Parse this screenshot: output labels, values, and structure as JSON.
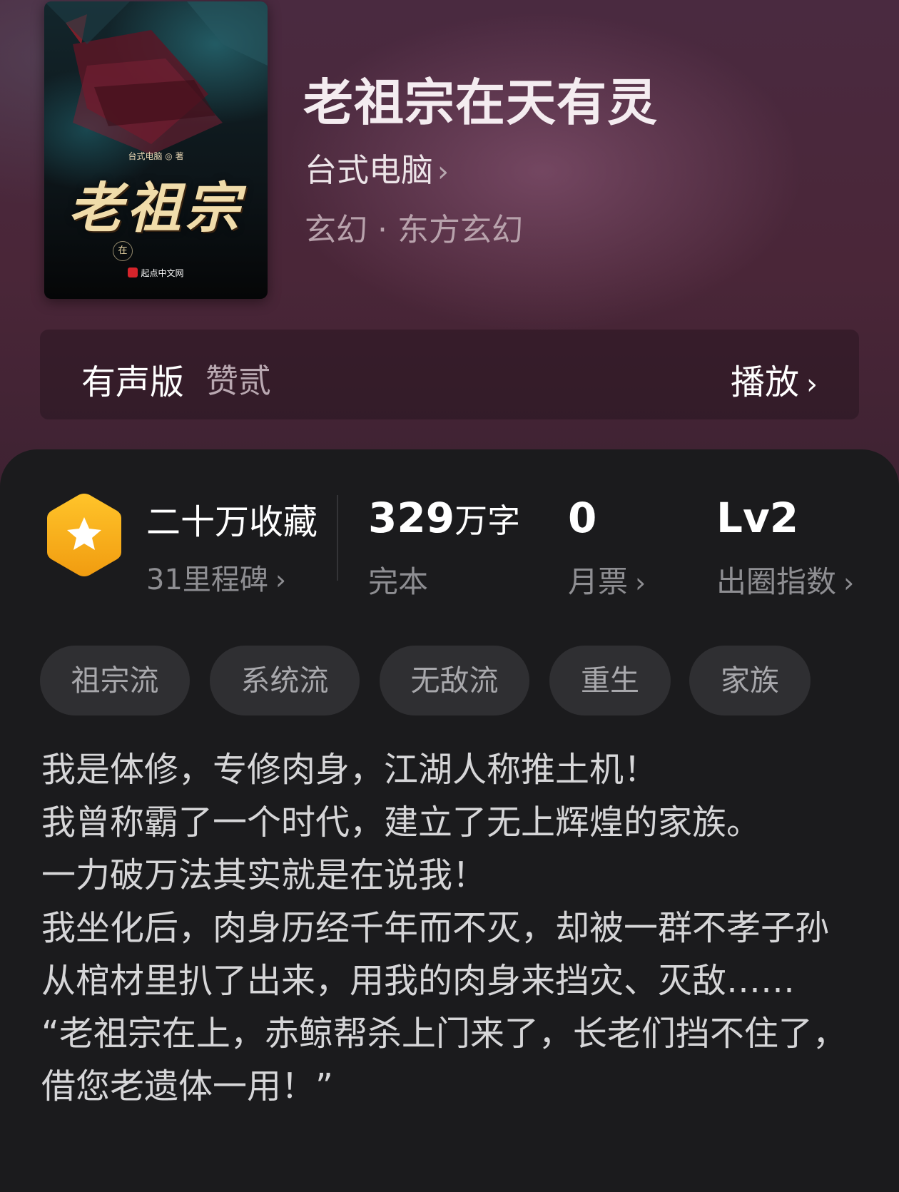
{
  "book": {
    "title": "老祖宗在天有灵",
    "author": "台式电脑",
    "genre": "玄幻 · 东方玄幻"
  },
  "cover": {
    "title": "老祖宗",
    "author_line": "台式电脑 ◎ 著",
    "subtitle_char": "在",
    "publisher": "起点中文网"
  },
  "audio": {
    "label": "有声版",
    "narrator": "赞贰",
    "play_label": "播放"
  },
  "stats": {
    "favorites": "二十万收藏",
    "milestones": "31里程碑",
    "word_count": "329",
    "word_unit": "万字",
    "status": "完本",
    "monthly_votes": "0",
    "monthly_votes_label": "月票",
    "level": "Lv2",
    "level_label": "出圈指数"
  },
  "tags": [
    "祖宗流",
    "系统流",
    "无敌流",
    "重生",
    "家族"
  ],
  "synopsis": [
    "我是体修，专修肉身，江湖人称推土机！",
    "我曾称霸了一个时代，建立了无上辉煌的家族。",
    "一力破万法其实就是在说我！",
    "我坐化后，肉身历经千年而不灭，却被一群不孝子孙从棺材里扒了出来，用我的肉身来挡灾、灭敌……",
    "“老祖宗在上，赤鲸帮杀上门来了，长老们挡不住了，借您老遗体一用！”"
  ],
  "colors": {
    "hero_bg": "#4a2638",
    "panel_bg": "#1b1b1d",
    "badge_gold": "#f6b21b",
    "tag_bg": "#2f2f32"
  },
  "icons": {
    "badge": "star-hexagon-icon",
    "chevron": "chevron-right-icon"
  }
}
